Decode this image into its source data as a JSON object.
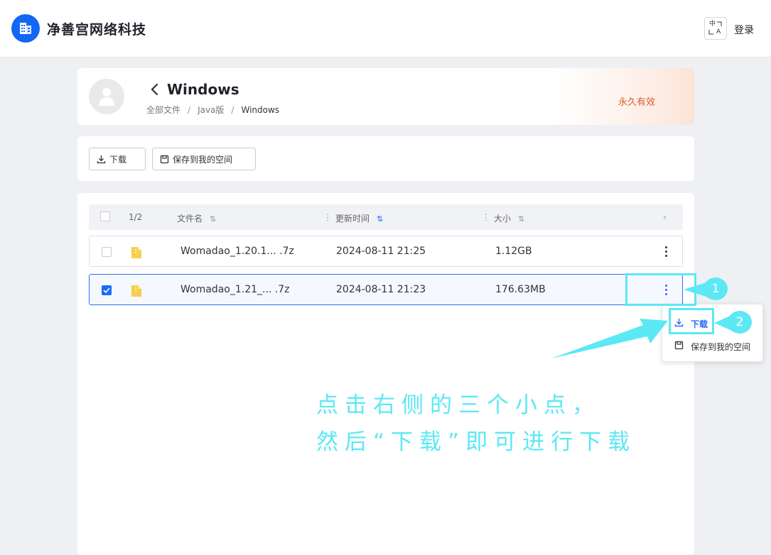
{
  "header": {
    "brand": "净善宫网络科技",
    "lang_top": "中",
    "lang_bottom": "A",
    "login": "登录"
  },
  "share": {
    "title": "Windows",
    "breadcrumb": [
      "全部文件",
      "Java版",
      "Windows"
    ],
    "validity": "永久有效"
  },
  "toolbar": {
    "download_label": "下载",
    "save_label": "保存到我的空间"
  },
  "table": {
    "count": "1/2",
    "columns": {
      "name": "文件名",
      "time": "更新时间",
      "size": "大小"
    },
    "rows": [
      {
        "name": "Womadao_1.20.1... .7z",
        "time": "2024-08-11 21:25",
        "size": "1.12GB",
        "checked": false
      },
      {
        "name": "Womadao_1.21_... .7z",
        "time": "2024-08-11 21:23",
        "size": "176.63MB",
        "checked": true
      }
    ]
  },
  "context_menu": {
    "download": "下载",
    "save": "保存到我的空间"
  },
  "annotation": {
    "badge_1": "1",
    "badge_2": "2",
    "line1": "点击右侧的三个小点，",
    "line2": "然后“下载”即可进行下载",
    "color": "#5ce8f4"
  },
  "colors": {
    "accent": "#1466f5",
    "validity": "#d4602a",
    "highlight": "#5ce8f4"
  }
}
